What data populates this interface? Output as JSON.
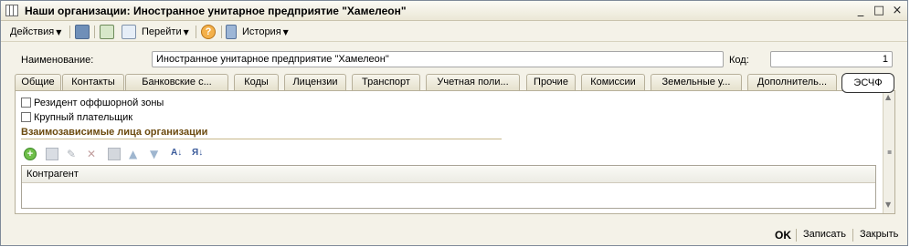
{
  "window": {
    "title": "Наши организации: Иностранное унитарное предприятие \"Хамелеон\"",
    "controls": [
      "_",
      "□",
      "×"
    ]
  },
  "toolbar": {
    "actions_label": "Действия",
    "goto_label": "Перейти",
    "help_label": "?",
    "history_label": "История"
  },
  "form": {
    "name_label": "Наименование:",
    "name_value": "Иностранное унитарное предприятие \"Хамелеон\"",
    "code_label": "Код:",
    "code_value": "1"
  },
  "tabs": [
    "Общие",
    "Контакты",
    "Банковские с...",
    "Коды",
    "Лицензии",
    "Транспорт",
    "Учетная поли...",
    "Прочие",
    "Комиссии",
    "Земельные у...",
    "Дополнитель...",
    "ЭСЧФ"
  ],
  "active_tab_index": 11,
  "esc_tab": {
    "offshore_label": "Резидент оффшорной зоны",
    "offshore_checked": false,
    "large_payer_label": "Крупный плательщик",
    "large_payer_checked": false,
    "related_section_title": "Взаимозависимые лица организации",
    "grid_column": "Контрагент"
  },
  "bottom": {
    "ok_label": "OK",
    "save_label": "Записать",
    "close_label": "Закрыть"
  }
}
